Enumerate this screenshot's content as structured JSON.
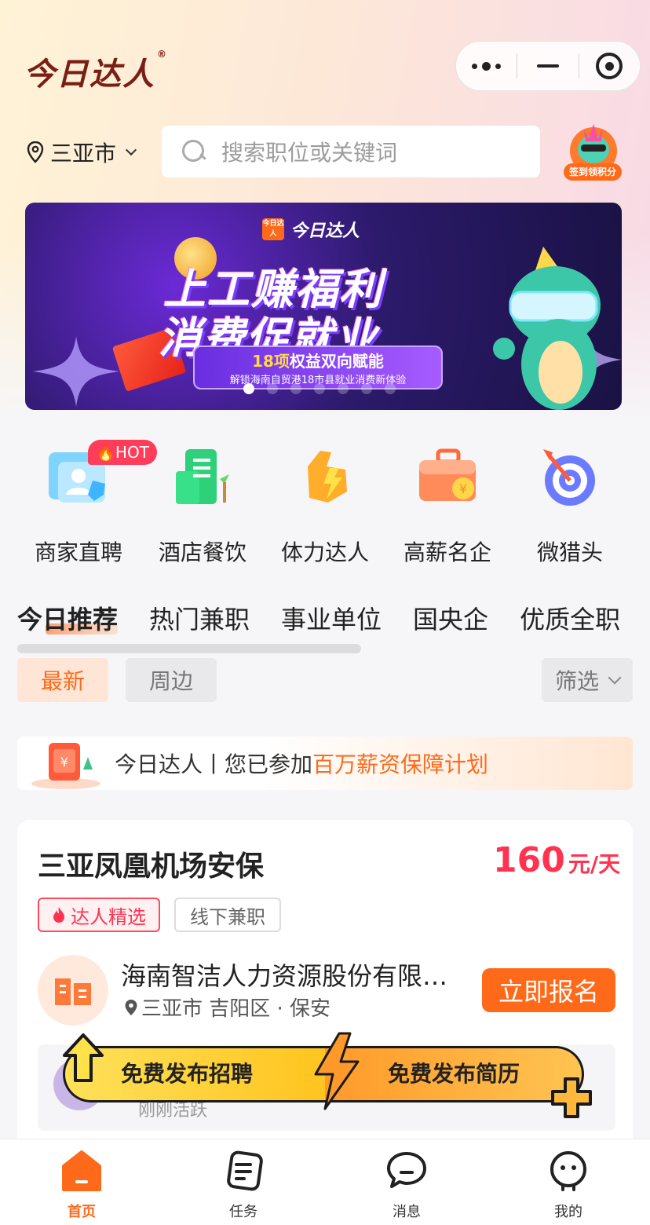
{
  "app": {
    "logo_text": "今日达人",
    "logo_mark": "®"
  },
  "location": {
    "city": "三亚市"
  },
  "search": {
    "placeholder": "搜索职位或关键词"
  },
  "mascot_badge": "签到领积分",
  "banner": {
    "brand": "今日达人",
    "brand_square": "今日达人",
    "headline_1": "上工赚福利",
    "headline_2": "消费促就业",
    "pill_count": "18项",
    "pill_title": "权益双向赋能",
    "pill_sub": "解锁海南自贸港18市县就业消费新体验",
    "slide_count": 7,
    "active_slide": 1
  },
  "categories": [
    {
      "label": "商家直聘",
      "badge": "HOT"
    },
    {
      "label": "酒店餐饮"
    },
    {
      "label": "体力达人"
    },
    {
      "label": "高薪名企"
    },
    {
      "label": "微猎头"
    }
  ],
  "tabs": [
    "今日推荐",
    "热门兼职",
    "事业单位",
    "国央企",
    "优质全职"
  ],
  "filters": {
    "latest": "最新",
    "nearby": "周边",
    "filter": "筛选"
  },
  "promo": {
    "prefix": "今日达人丨您已参加",
    "highlight": "百万薪资保障计划"
  },
  "job": {
    "title": "三亚凤凰机场安保",
    "salary": "160",
    "salary_unit": "元/天",
    "tag_featured": "达人精选",
    "tag_type": "线下兼职",
    "company": "海南智洁人力资源股份有限…",
    "location": "三亚市 吉阳区 · 保安",
    "apply_label": "立即报名",
    "recruiter_status": "刚刚活跃"
  },
  "publish_bar": {
    "left": "免费发布招聘",
    "right": "免费发布简历"
  },
  "nav": [
    {
      "label": "首页",
      "active": true
    },
    {
      "label": "任务"
    },
    {
      "label": "消息"
    },
    {
      "label": "我的"
    }
  ],
  "colors": {
    "accent": "#ff6a1a",
    "price": "#ff3350",
    "logo": "#7a1f16"
  }
}
